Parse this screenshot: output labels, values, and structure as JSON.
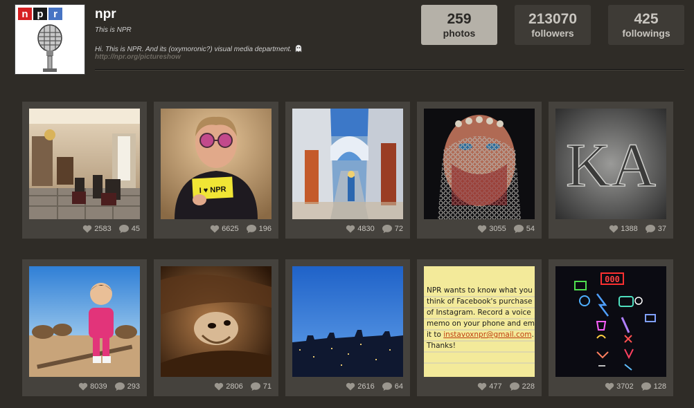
{
  "profile": {
    "username": "npr",
    "full_name": "This is NPR",
    "bio": "Hi. This is NPR. And its (oxymoronic?) visual media department.",
    "website": "http://npr.org/pictureshow",
    "logo_letters": [
      "n",
      "p",
      "r"
    ],
    "logo_colors": [
      "#d62021",
      "#1a1a1a",
      "#4774c4"
    ]
  },
  "stats": [
    {
      "value": "259",
      "label": "photos",
      "active": true
    },
    {
      "value": "213070",
      "label": "followers",
      "active": false
    },
    {
      "value": "425",
      "label": "followings",
      "active": false
    }
  ],
  "photos": [
    {
      "likes": "2583",
      "comments": "45",
      "subject": "ornate-room-meeting"
    },
    {
      "likes": "6625",
      "comments": "196",
      "subject": "man-with-i-love-npr-sign",
      "sign_text": "I ♥ NPR"
    },
    {
      "likes": "4830",
      "comments": "72",
      "subject": "blue-alley-arch"
    },
    {
      "likes": "3055",
      "comments": "54",
      "subject": "woman-with-chain-veil"
    },
    {
      "likes": "1388",
      "comments": "37",
      "subject": "carved-stone-letters",
      "carving": "KA"
    },
    {
      "likes": "8039",
      "comments": "293",
      "subject": "girl-in-pink-with-camels"
    },
    {
      "likes": "2806",
      "comments": "71",
      "subject": "camel-closeup"
    },
    {
      "likes": "2616",
      "comments": "64",
      "subject": "city-at-dusk"
    },
    {
      "likes": "477",
      "comments": "228",
      "subject": "handwritten-note",
      "note_lines": [
        "NPR wants to know what you",
        "think of Facebook's purchase",
        "of Instagram. Record a voice",
        "memo on your phone and email",
        "it to instavoxnpr@gmail.com.",
        "Thanks!"
      ],
      "email": "instavoxnpr@gmail.com"
    },
    {
      "likes": "3702",
      "comments": "128",
      "subject": "neon-signs",
      "neon_text": "000"
    }
  ]
}
